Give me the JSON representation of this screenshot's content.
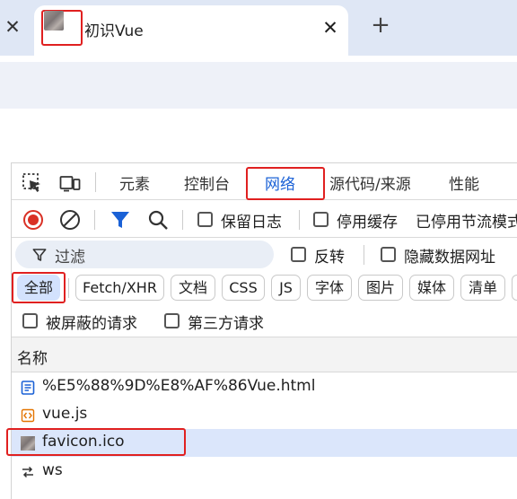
{
  "browser": {
    "tab_title": "初识Vue",
    "new_tab_label": "+",
    "close_glyph": "✕"
  },
  "devtools": {
    "tabs": [
      {
        "label": "元素"
      },
      {
        "label": "控制台"
      },
      {
        "label": "网络",
        "active": true
      },
      {
        "label": "源代码/来源"
      },
      {
        "label": "性能"
      }
    ],
    "toolbar": {
      "preserve_log": "保留日志",
      "disable_cache": "停用缓存",
      "throttling": "已停用节流模式"
    },
    "filter": {
      "placeholder": "过滤",
      "invert": "反转",
      "hide_data_urls": "隐藏数据网址"
    },
    "type_filters": [
      "全部",
      "Fetch/XHR",
      "文档",
      "CSS",
      "JS",
      "字体",
      "图片",
      "媒体",
      "清单"
    ],
    "selected_type": "全部",
    "blocked_requests": "被屏蔽的请求",
    "third_party_requests": "第三方请求",
    "column_name": "名称",
    "requests": [
      {
        "name": "%E5%88%9D%E8%AF%86Vue.html",
        "icon": "document-icon"
      },
      {
        "name": "vue.js",
        "icon": "script-icon"
      },
      {
        "name": "favicon.ico",
        "icon": "image-icon",
        "selected": true
      },
      {
        "name": "ws",
        "icon": "websocket-icon"
      }
    ]
  },
  "colors": {
    "accent": "#1a61d6",
    "highlight_box": "#e02020",
    "tabstrip_bg": "#dfe7f5",
    "selected_row": "#dbe6fb"
  }
}
